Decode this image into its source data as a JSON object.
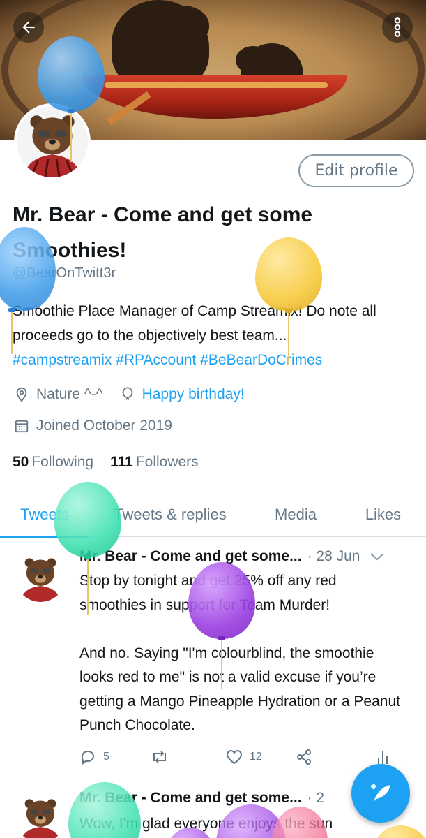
{
  "colors": {
    "accent": "#1da1f2",
    "text_primary": "#14171a",
    "text_secondary": "#657786",
    "divider": "#d8dee3",
    "balloon_blue": "#4aa8f0",
    "balloon_yellow": "#f6c93a",
    "balloon_green": "#3de0b0",
    "balloon_purple": "#9a3ee0",
    "balloon_pink": "#f06a8f"
  },
  "header": {
    "back_icon": "arrow-left-icon",
    "more_icon": "more-vertical-icon",
    "edit_profile_label": "Edit profile"
  },
  "profile": {
    "name": "Mr. Bear - Come and get some Smoothies!",
    "handle": "@BearOnTwitt3r",
    "bio_text": "Smoothie Place Manager of Camp Streamix! Do note all proceeds go to the objectively best team...",
    "bio_tags": "#campstreamix #RPAccount #BeBearDoCrimes",
    "location": "Nature ^-^",
    "birthday": "Happy birthday!",
    "joined": "Joined October 2019",
    "following_count": "50",
    "following_label": "Following",
    "followers_count": "111",
    "followers_label": "Followers"
  },
  "tabs": [
    {
      "label": "Tweets",
      "active": true
    },
    {
      "label": "Tweets & replies",
      "active": false
    },
    {
      "label": "Media",
      "active": false
    },
    {
      "label": "Likes",
      "active": false
    }
  ],
  "tweets": [
    {
      "name": "Mr. Bear - Come and get some...",
      "date": "· 28 Jun",
      "text": "Stop by tonight and get 25% off any red smoothies in support for Team Murder!\n\nAnd no. Saying \"I'm colourblind, the smoothie looks red to me\" is not a valid excuse if you’re getting a Mango Pineapple Hydration or a Peanut Punch Chocolate.",
      "replies": "5",
      "retweets": "",
      "likes": "12"
    },
    {
      "name": "Mr. Bear - Come and get some...",
      "date": "· 2",
      "text": "Wow, I'm glad everyone enjoys the sun"
    }
  ],
  "fab": {
    "icon": "compose-tweet-icon"
  }
}
